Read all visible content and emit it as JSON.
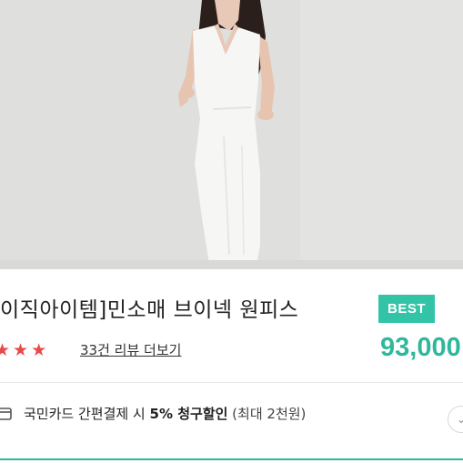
{
  "product": {
    "title": "이직아이템]민소매 브이넥 원피스",
    "badge": "BEST",
    "price": "93,000",
    "rating": 3,
    "review_link": "33건 리뷰 더보기"
  },
  "promo": {
    "card_text": "국민카드 간편결제 시 ",
    "discount": "5% 청구할인",
    "limit": " (최대 2천원)"
  },
  "colors": {
    "accent": "#33c3a7",
    "star": "#e94a4a"
  },
  "icons": {
    "card": "card-icon",
    "more": "more-button"
  }
}
